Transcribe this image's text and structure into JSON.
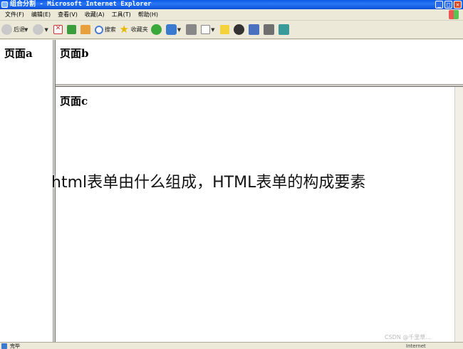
{
  "window": {
    "title": "组合分割 - Microsoft Internet Explorer",
    "controls": [
      "_",
      "□",
      "✕"
    ]
  },
  "menu": [
    "文件(F)",
    "编辑(E)",
    "查看(V)",
    "收藏(A)",
    "工具(T)",
    "帮助(H)"
  ],
  "toolbar": {
    "back_label": "后退",
    "search_label": "搜索",
    "favorites_label": "收藏夹"
  },
  "frames": {
    "a": "页面a",
    "b": "页面b",
    "c": "页面c"
  },
  "overlay_text": "html表单由什么组成，HTML表单的构成要素",
  "status": {
    "text": "完毕",
    "zone": "Internet",
    "watermark": "CSDN @千里草..."
  }
}
